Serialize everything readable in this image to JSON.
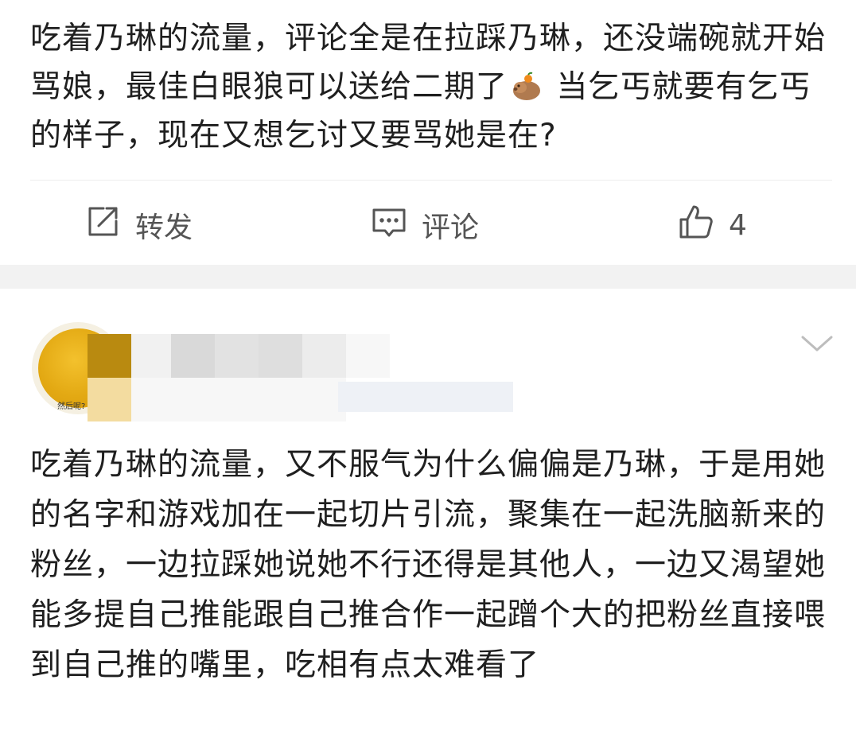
{
  "post": {
    "text_before_emoji": "吃着乃琳的流量，评论全是在拉踩乃琳，还没端碗就开始骂娘，最佳白眼狼可以送给二期了",
    "emoji": "capybara-emoji",
    "text_after_emoji": " 当乞丐就要有乞丐的样子，现在又想乞讨又要骂她是在?"
  },
  "actions": {
    "repost_label": "转发",
    "comment_label": "评论",
    "like_count": "4"
  },
  "comment": {
    "avatar_caption": "然后呢?",
    "text": "吃着乃琳的流量，又不服气为什么偏偏是乃琳，于是用她的名字和游戏加在一起切片引流，聚集在一起洗脑新来的粉丝，一边拉踩她说她不行还得是其他人，一边又渴望她能多提自己推能跟自己推合作一起蹭个大的把粉丝直接喂到自己推的嘴里，吃相有点太难看了"
  },
  "colors": {
    "text": "#1f1f1f",
    "icon": "#555555",
    "separator": "#f2f2f2",
    "avatar": "#e3a913"
  }
}
